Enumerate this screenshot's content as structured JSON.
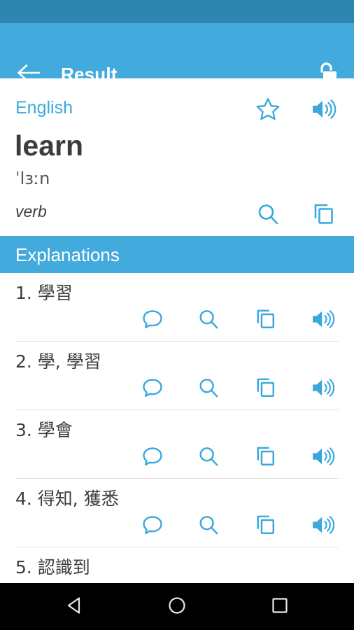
{
  "colors": {
    "status_bar": "#2d86b0",
    "app_bar": "#42aadd",
    "accent": "#3aa8dd",
    "text_primary": "#3d3d3d",
    "divider": "#e2e2e2",
    "nav_bar": "#000000"
  },
  "status_bar": {
    "name": "status-bar"
  },
  "app_bar": {
    "back_icon": "arrow-left-icon",
    "title": "Result",
    "lock_icon": "lock-open-icon"
  },
  "word": {
    "language": "English",
    "headword": "learn",
    "phonetic": "ˈlɜːn",
    "part_of_speech": "verb",
    "favorite_icon": "star-outline-icon",
    "speak_icon": "volume-up-icon",
    "search_icon": "search-icon",
    "copy_icon": "copy-icon"
  },
  "section": {
    "title": "Explanations"
  },
  "explanations": {
    "row_icons": [
      {
        "icon": "comment-icon",
        "label": "Comment"
      },
      {
        "icon": "search-icon",
        "label": "Search"
      },
      {
        "icon": "copy-icon",
        "label": "Copy"
      },
      {
        "icon": "volume-up-icon",
        "label": "Speak"
      }
    ],
    "items": [
      {
        "number": "1.",
        "text": "1. 學習"
      },
      {
        "number": "2.",
        "text": "2. 學, 學習"
      },
      {
        "number": "3.",
        "text": "3. 學會"
      },
      {
        "number": "4.",
        "text": "4. 得知, 獲悉"
      },
      {
        "number": "5.",
        "text": "5. 認識到"
      }
    ]
  },
  "nav_bar": {
    "back_icon": "nav-back-triangle-icon",
    "home_icon": "nav-home-circle-icon",
    "recents_icon": "nav-recents-square-icon"
  }
}
